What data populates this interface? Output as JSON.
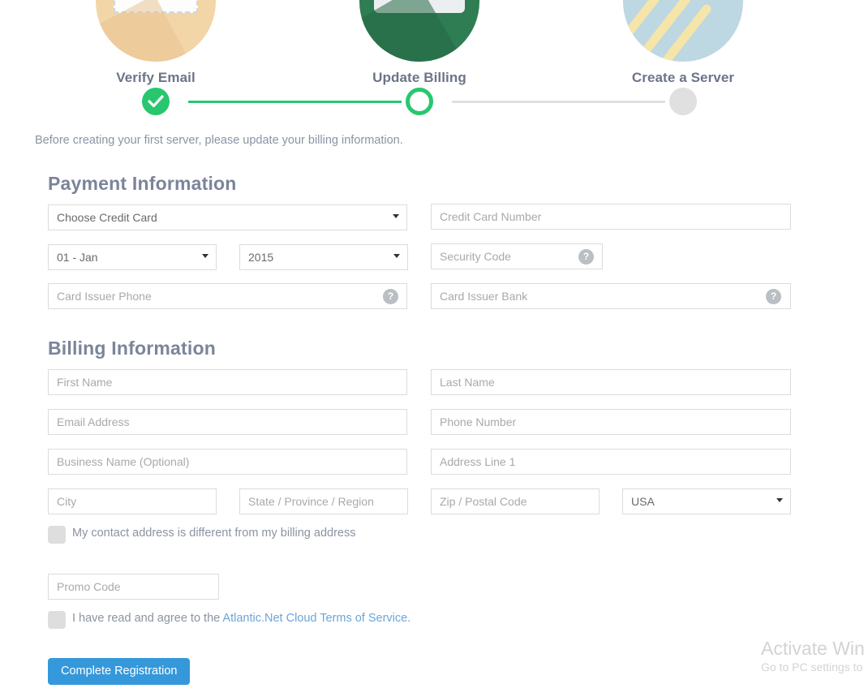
{
  "steps": {
    "items": [
      {
        "label": "Verify Email",
        "state": "done",
        "art": "envelope-illustration"
      },
      {
        "label": "Update Billing",
        "state": "current",
        "art": "credit-card-illustration"
      },
      {
        "label": "Create a Server",
        "state": "todo",
        "art": "rocket-illustration"
      }
    ],
    "done_color": "#28c76f",
    "todo_color": "#e0e0e0"
  },
  "intro": "Before creating your first server, please update your billing information.",
  "payment": {
    "title": "Payment Information",
    "credit_card_select": "Choose Credit Card",
    "credit_card_number_placeholder": "Credit Card Number",
    "exp_month": "01 - Jan",
    "exp_year": "2015",
    "security_code_placeholder": "Security Code",
    "card_issuer_phone_placeholder": "Card Issuer Phone",
    "card_issuer_bank_placeholder": "Card Issuer Bank",
    "help_glyph": "?"
  },
  "billing": {
    "title": "Billing Information",
    "first_name_placeholder": "First Name",
    "last_name_placeholder": "Last Name",
    "email_placeholder": "Email Address",
    "phone_placeholder": "Phone Number",
    "business_placeholder": "Business Name (Optional)",
    "address_placeholder": "Address Line 1",
    "city_placeholder": "City",
    "state_placeholder": "State / Province / Region",
    "zip_placeholder": "Zip / Postal Code",
    "country": "USA",
    "contact_diff_label": "My contact address is different from my billing address",
    "promo_placeholder": "Promo Code"
  },
  "terms": {
    "prefix": "I have read and agree to the ",
    "link": "Atlantic.Net Cloud Terms of Service",
    "suffix": "."
  },
  "submit_label": "Complete Registration",
  "watermark": {
    "line1": "Activate Windows",
    "line2": "Go to PC settings to activate Windows."
  },
  "colors": {
    "accent_green": "#28c76f",
    "button_blue": "#3498db",
    "link_blue": "#6ba5d7",
    "heading_slate": "#7b8499"
  }
}
